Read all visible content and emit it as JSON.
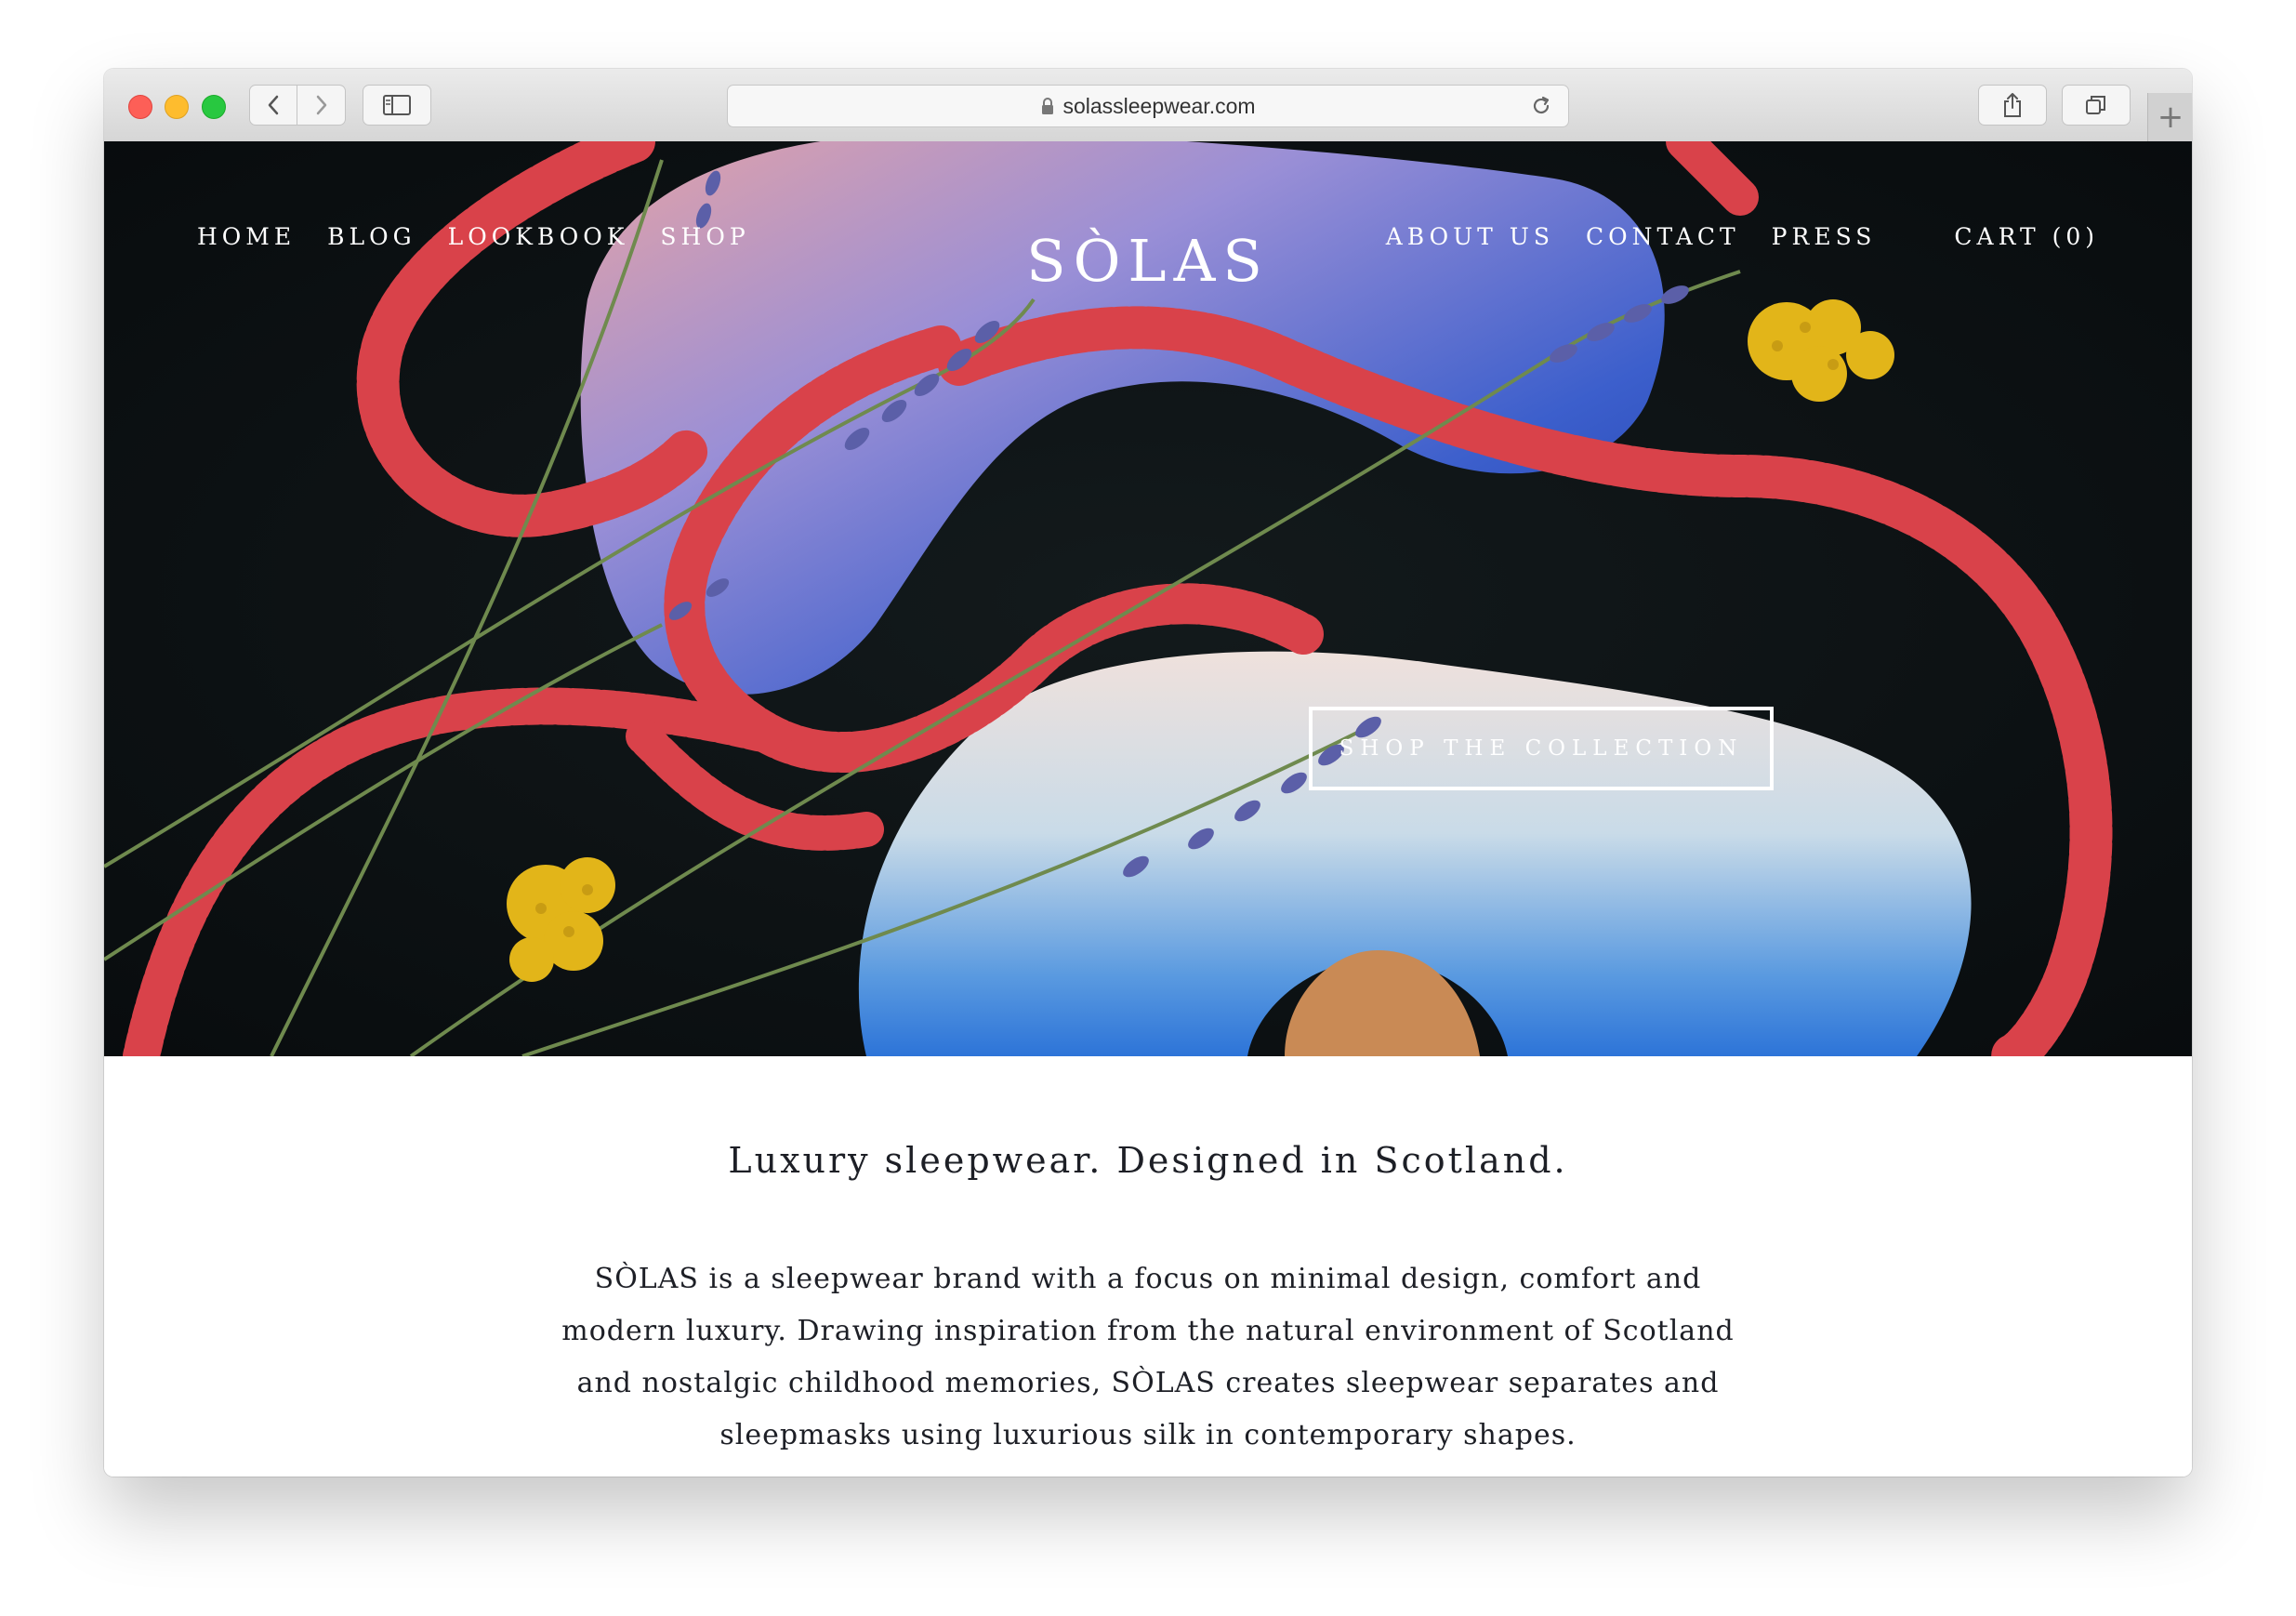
{
  "browser": {
    "url": "solassleepwear.com"
  },
  "nav": {
    "left": [
      "HOME",
      "BLOG",
      "LOOKBOOK",
      "SHOP"
    ],
    "right": [
      "ABOUT US",
      "CONTACT",
      "PRESS"
    ],
    "cart": "CART (0)"
  },
  "brand": {
    "logo": "SÒLAS"
  },
  "hero": {
    "cta_label": "SHOP THE COLLECTION"
  },
  "intro": {
    "tagline": "Luxury sleepwear. Designed in Scotland.",
    "body": "SÒLAS is a sleepwear brand with a focus on minimal design, comfort and modern luxury. Drawing inspiration from the natural environment of Scotland and nostalgic childhood memories, SÒLAS creates sleepwear separates and sleepmasks using luxurious silk in contemporary shapes."
  },
  "colors": {
    "hero_background": "#0d1114",
    "ribbon_red": "#d9424a",
    "mask_blue": "#3f6fd6",
    "mask_pink": "#e0a0a6",
    "flower_yellow": "#e2b519",
    "lavender": "#5b5fa8",
    "text_dark": "#1d1f26"
  }
}
